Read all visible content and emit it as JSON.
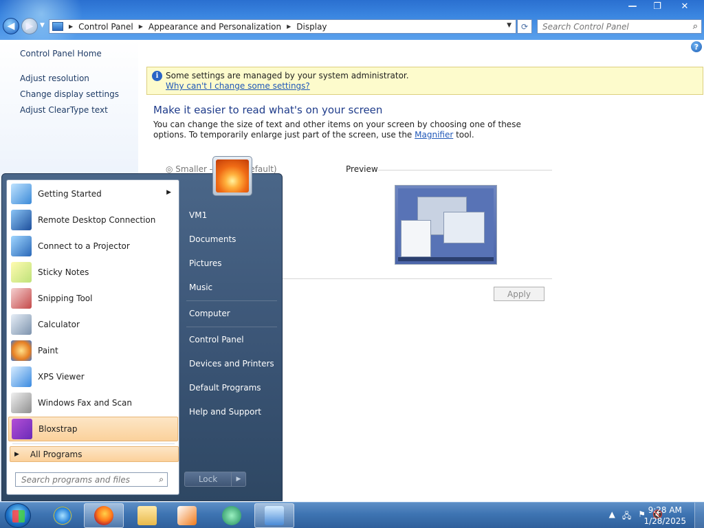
{
  "window": {
    "minimize": "—",
    "restore": "❐",
    "close": "✕"
  },
  "address": {
    "crumbs": [
      "Control Panel",
      "Appearance and Personalization",
      "Display"
    ],
    "search_placeholder": "Search Control Panel"
  },
  "sidebar": {
    "home": "Control Panel Home",
    "links": [
      "Adjust resolution",
      "Change display settings",
      "Adjust ClearType text"
    ]
  },
  "info": {
    "message": "Some settings are managed by your system administrator.",
    "link": "Why can't I change some settings?"
  },
  "main": {
    "heading": "Make it easier to read what's on your screen",
    "desc_before": "You can change the size of text and other items on your screen by choosing one of these options. To temporarily enlarge just part of the screen, use the ",
    "desc_link": "Magnifier",
    "desc_after": " tool.",
    "option_smaller": "◎ Smaller - 100% (default)",
    "preview_label": "Preview",
    "apply": "Apply"
  },
  "start_menu": {
    "programs": [
      {
        "label": "Getting Started",
        "icon": "getting-started-icon",
        "arrow": "▶"
      },
      {
        "label": "Remote Desktop Connection",
        "icon": "remote-desktop-icon"
      },
      {
        "label": "Connect to a Projector",
        "icon": "projector-icon"
      },
      {
        "label": "Sticky Notes",
        "icon": "sticky-notes-icon"
      },
      {
        "label": "Snipping Tool",
        "icon": "snipping-tool-icon"
      },
      {
        "label": "Calculator",
        "icon": "calculator-icon"
      },
      {
        "label": "Paint",
        "icon": "paint-icon"
      },
      {
        "label": "XPS Viewer",
        "icon": "xps-viewer-icon"
      },
      {
        "label": "Windows Fax and Scan",
        "icon": "fax-scan-icon"
      },
      {
        "label": "Bloxstrap",
        "icon": "bloxstrap-icon"
      }
    ],
    "all_programs": "All Programs",
    "search_placeholder": "Search programs and files",
    "right_links": [
      "VM1",
      "Documents",
      "Pictures",
      "Music",
      "Computer",
      "Control Panel",
      "Devices and Printers",
      "Default Programs",
      "Help and Support"
    ],
    "lock": "Lock",
    "lock_arrow": "▶"
  },
  "taskbar": {
    "time": "9:28 AM",
    "date": "1/28/2025",
    "tray_up": "▲"
  }
}
